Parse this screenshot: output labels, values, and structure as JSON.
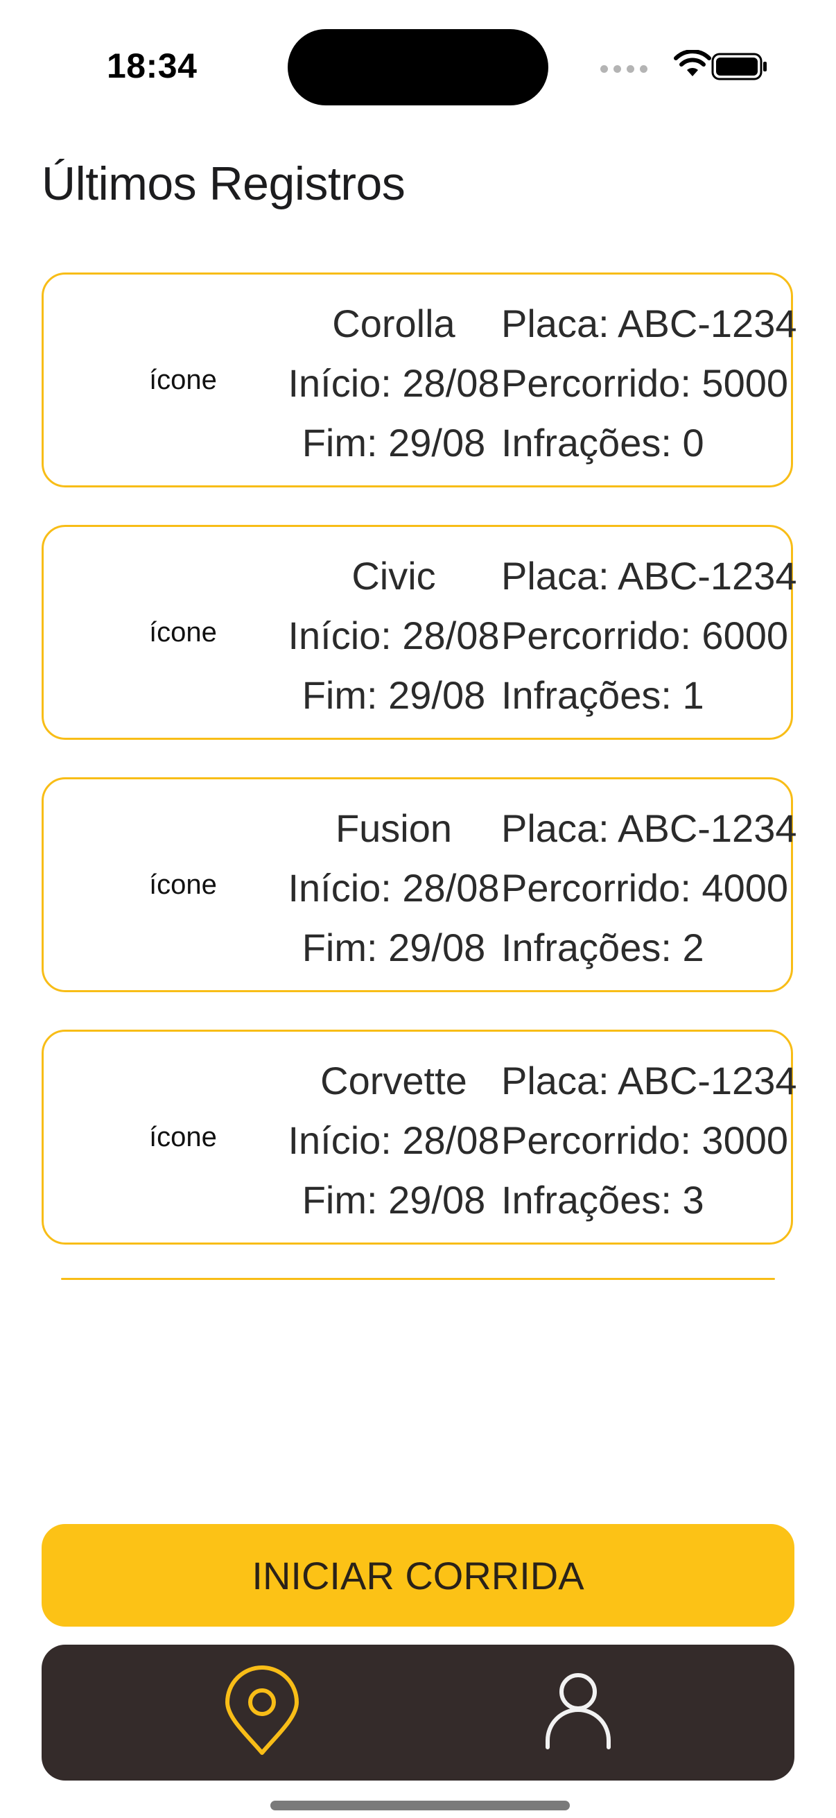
{
  "status_bar": {
    "time": "18:34"
  },
  "header": {
    "title": "Últimos Registros"
  },
  "records": [
    {
      "icon_label": "ícone",
      "model": "Corolla",
      "start": "Início: 28/08",
      "end": "Fim: 29/08",
      "plate": "Placa: ABC-1234",
      "distance": "Percorrido: 5000",
      "infractions": "Infrações: 0"
    },
    {
      "icon_label": "ícone",
      "model": "Civic",
      "start": "Início: 28/08",
      "end": "Fim: 29/08",
      "plate": "Placa: ABC-1234",
      "distance": "Percorrido: 6000",
      "infractions": "Infrações: 1"
    },
    {
      "icon_label": "ícone",
      "model": "Fusion",
      "start": "Início: 28/08",
      "end": "Fim: 29/08",
      "plate": "Placa: ABC-1234",
      "distance": "Percorrido: 4000",
      "infractions": "Infrações: 2"
    },
    {
      "icon_label": "ícone",
      "model": "Corvette",
      "start": "Início: 28/08",
      "end": "Fim: 29/08",
      "plate": "Placa: ABC-1234",
      "distance": "Percorrido: 3000",
      "infractions": "Infrações: 3"
    }
  ],
  "actions": {
    "start_label": "INICIAR CORRIDA"
  },
  "tab_bar": {
    "tabs": [
      {
        "icon": "location-pin-icon",
        "active": true
      },
      {
        "icon": "person-icon",
        "active": false
      }
    ]
  },
  "colors": {
    "accent": "#fcc216",
    "card_border": "#f8bd17",
    "tab_bar_bg": "#342b2a",
    "tab_icon_inactive": "#f2f2f2"
  }
}
